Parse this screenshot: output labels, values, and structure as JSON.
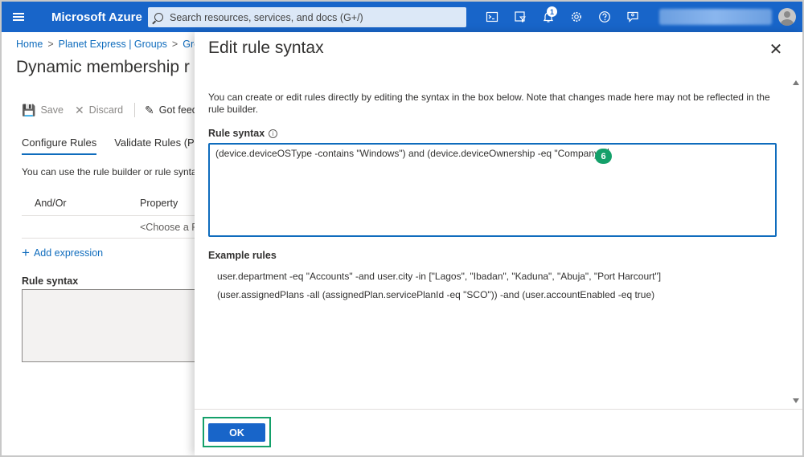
{
  "topbar": {
    "brand": "Microsoft Azure",
    "search_placeholder": "Search resources, services, and docs (G+/)",
    "notification_count": "1",
    "icons": [
      "cloud-shell-icon",
      "directory-filter-icon",
      "bell-icon",
      "gear-icon",
      "help-icon",
      "feedback-icon"
    ]
  },
  "background": {
    "breadcrumb": [
      "Home",
      "Planet Express | Groups",
      "Grou"
    ],
    "title": "Dynamic membership r",
    "toolbar": {
      "save": "Save",
      "discard": "Discard",
      "feedback": "Got feedb"
    },
    "tabs": [
      "Configure Rules",
      "Validate Rules (Prev"
    ],
    "hint": "You can use the rule builder or rule syntax",
    "columns": [
      "And/Or",
      "Property"
    ],
    "row_property": "<Choose a Pr",
    "add_expression": "Add expression",
    "rule_syntax_label": "Rule syntax"
  },
  "panel": {
    "title": "Edit rule syntax",
    "description": "You can create or edit rules directly by editing the syntax in the box below. Note that changes made here may not be reflected in the rule builder.",
    "rule_syntax_label": "Rule syntax",
    "rule_syntax_value": "(device.deviceOSType -contains \"Windows\") and (device.deviceOwnership -eq \"Company\")",
    "step_badge": "6",
    "example_label": "Example rules",
    "examples": [
      "user.department -eq \"Accounts\" -and user.city -in [\"Lagos\", \"Ibadan\", \"Kaduna\", \"Abuja\", \"Port Harcourt\"]",
      "(user.assignedPlans -all (assignedPlan.servicePlanId -eq \"SCO\")) -and (user.accountEnabled -eq true)"
    ],
    "ok_label": "OK"
  },
  "colors": {
    "brand_blue": "#1865c9",
    "highlight_green": "#14a06a"
  }
}
